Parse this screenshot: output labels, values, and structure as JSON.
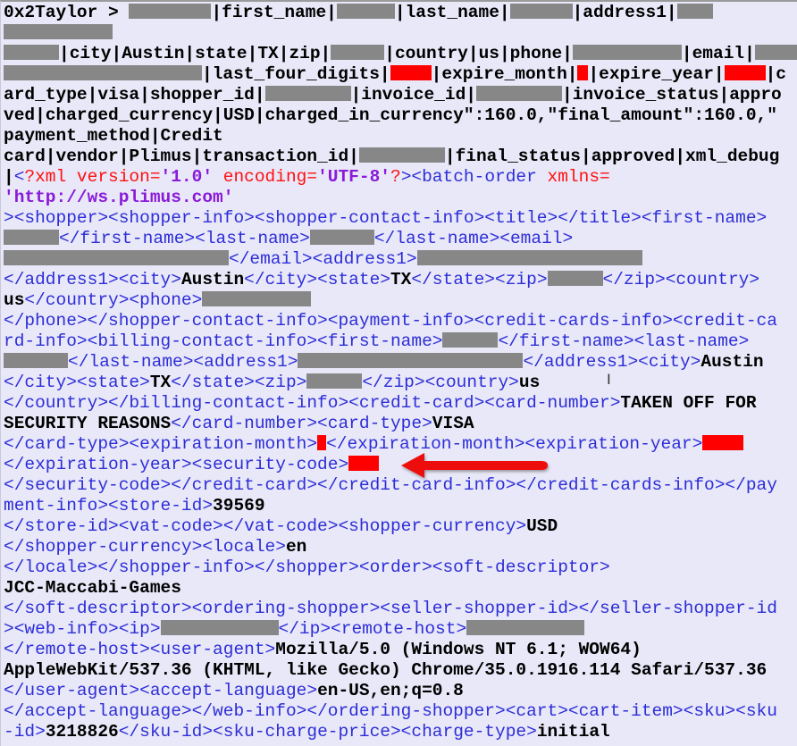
{
  "document": {
    "kind": "raw log dump with embedded XML",
    "lines": [
      [
        [
          "b",
          "0x2Taylor > "
        ],
        [
          "g",
          ""
        ],
        [
          "b",
          "|first_name|"
        ],
        [
          "g",
          ""
        ],
        [
          "b",
          "|last_name|"
        ],
        [
          "g",
          ""
        ],
        [
          "b",
          "|address1|"
        ],
        [
          "g",
          ""
        ]
      ],
      [
        [
          "g",
          ""
        ]
      ],
      [
        [
          "g",
          ""
        ],
        [
          "b",
          "|city|Austin|state|TX|zip|"
        ],
        [
          "g",
          ""
        ],
        [
          "b",
          "|country|us|phone|"
        ],
        [
          "g",
          ""
        ],
        [
          "b",
          "|email|"
        ],
        [
          "g",
          ""
        ]
      ],
      [
        [
          "g",
          ""
        ],
        [
          "b",
          "|last_four_digits|"
        ],
        [
          "x",
          ""
        ],
        [
          "b",
          "|expire_month|"
        ],
        [
          "x",
          ""
        ],
        [
          "b",
          "|expire_year|"
        ],
        [
          "x",
          ""
        ],
        [
          "b",
          "|c"
        ]
      ],
      [
        [
          "b",
          "ard_type|visa|shopper_id|"
        ],
        [
          "g",
          ""
        ],
        [
          "b",
          "|invoice_id|"
        ],
        [
          "g",
          ""
        ],
        [
          "b",
          "|invoice_status|appro"
        ]
      ],
      [
        [
          "b",
          "ved|charged_currency|USD|charged_in_currency\":160.0,\"final_amount\":160.0,\""
        ]
      ],
      [
        [
          "b",
          "payment_method|Credit"
        ]
      ],
      [
        [
          "b",
          "card|vendor|Plimus|transaction_id|"
        ],
        [
          "g",
          ""
        ],
        [
          "b",
          "|final_status|approved|xml_debug"
        ]
      ],
      [
        [
          "b",
          "|"
        ],
        [
          "t",
          "<"
        ],
        [
          "r",
          "?xml version="
        ],
        [
          "v",
          "'1.0'"
        ],
        [
          "r",
          " encoding="
        ],
        [
          "v",
          "'UTF-8'"
        ],
        [
          "r",
          "?"
        ],
        [
          "t",
          ">"
        ],
        [
          "t",
          "<batch-order "
        ],
        [
          "r",
          "xmlns="
        ]
      ],
      [
        [
          "v",
          "'http://ws.plimus.com'"
        ]
      ],
      [
        [
          "t",
          "><shopper><shopper-info><shopper-contact-info><title></title><first-name>"
        ]
      ],
      [
        [
          "g",
          ""
        ],
        [
          "t",
          "</first-name><last-name>"
        ],
        [
          "g",
          ""
        ],
        [
          "t",
          "</last-name><email>"
        ]
      ],
      [
        [
          "g",
          ""
        ],
        [
          "t",
          "</email><address1>"
        ],
        [
          "g",
          ""
        ]
      ],
      [
        [
          "t",
          "</address1><city>"
        ],
        [
          "b",
          "Austin"
        ],
        [
          "t",
          "</city><state>"
        ],
        [
          "b",
          "TX"
        ],
        [
          "t",
          "</state><zip>"
        ],
        [
          "g",
          ""
        ],
        [
          "t",
          "</zip><country>"
        ]
      ],
      [
        [
          "b",
          "us"
        ],
        [
          "t",
          "</country><phone>"
        ],
        [
          "g",
          ""
        ]
      ],
      [
        [
          "t",
          "</phone></shopper-contact-info><payment-info><credit-cards-info><credit-ca"
        ]
      ],
      [
        [
          "t",
          "rd-info><billing-contact-info><first-name>"
        ],
        [
          "g",
          ""
        ],
        [
          "t",
          "</first-name><last-name>"
        ]
      ],
      [
        [
          "g",
          ""
        ],
        [
          "t",
          "</last-name><address1>"
        ],
        [
          "g",
          ""
        ],
        [
          "t",
          "</address1><city>"
        ],
        [
          "b",
          "Austin"
        ]
      ],
      [
        [
          "t",
          "</city><state>"
        ],
        [
          "b",
          "TX"
        ],
        [
          "t",
          "</state><zip>"
        ],
        [
          "g",
          ""
        ],
        [
          "t",
          "</zip><country>"
        ],
        [
          "b",
          "us"
        ]
      ],
      [
        [
          "t",
          "</country></billing-contact-info><credit-card><card-number>"
        ],
        [
          "b",
          "TAKEN OFF FOR"
        ]
      ],
      [
        [
          "b",
          "SECURITY REASONS"
        ],
        [
          "t",
          "</card-number><card-type>"
        ],
        [
          "b",
          "VISA"
        ]
      ],
      [
        [
          "t",
          "</card-type><expiration-month>"
        ],
        [
          "x",
          ""
        ],
        [
          "t",
          "</expiration-month><expiration-year>"
        ],
        [
          "x",
          ""
        ]
      ],
      [
        [
          "t",
          "</expiration-year><security-code>"
        ],
        [
          "x",
          ""
        ]
      ],
      [
        [
          "t",
          "</security-code></credit-card></credit-card-info></credit-cards-info></pay"
        ]
      ],
      [
        [
          "t",
          "ment-info><store-id>"
        ],
        [
          "b",
          "39569"
        ]
      ],
      [
        [
          "t",
          "</store-id><vat-code></vat-code><shopper-currency>"
        ],
        [
          "b",
          "USD"
        ]
      ],
      [
        [
          "t",
          "</shopper-currency><locale>"
        ],
        [
          "b",
          "en"
        ]
      ],
      [
        [
          "t",
          "</locale></shopper-info></shopper><order><soft-descriptor>"
        ]
      ],
      [
        [
          "b",
          "JCC-Maccabi-Games"
        ]
      ],
      [
        [
          "t",
          "</soft-descriptor><ordering-shopper><seller-shopper-id></seller-shopper-id"
        ]
      ],
      [
        [
          "t",
          "><web-info><ip>"
        ],
        [
          "g",
          ""
        ],
        [
          "t",
          "</ip><remote-host>"
        ],
        [
          "g",
          ""
        ]
      ],
      [
        [
          "t",
          "</remote-host><user-agent>"
        ],
        [
          "b",
          "Mozilla/5.0 (Windows NT 6.1; WOW64)"
        ]
      ],
      [
        [
          "b",
          "AppleWebKit/537.36 (KHTML, like Gecko) Chrome/35.0.1916.114 Safari/537.36"
        ]
      ],
      [
        [
          "t",
          "</user-agent><accept-language>"
        ],
        [
          "b",
          "en-US,en;q=0.8"
        ]
      ],
      [
        [
          "t",
          "</accept-language></web-info></ordering-shopper><cart><cart-item><sku><sku"
        ]
      ],
      [
        [
          "t",
          "-id>"
        ],
        [
          "b",
          "3218826"
        ],
        [
          "t",
          "</sku-id><sku-charge-price><charge-type>"
        ],
        [
          "b",
          "initial"
        ]
      ]
    ]
  },
  "annotations": {
    "arrow_icon": "red-arrow-left-icon",
    "arrow_target": "security-code value",
    "cursor_icon": "text-cursor-ibeam-icon"
  },
  "colors": {
    "background": "#e8e8f8",
    "value_text": "#000000",
    "xml_tag": "#2d2dd8",
    "xml_declaration": "#ff1010",
    "xml_attribute_value": "#8a1ad8",
    "redaction_gray": "#878787",
    "redaction_red": "#ff0000",
    "arrow": "#ee1111"
  }
}
